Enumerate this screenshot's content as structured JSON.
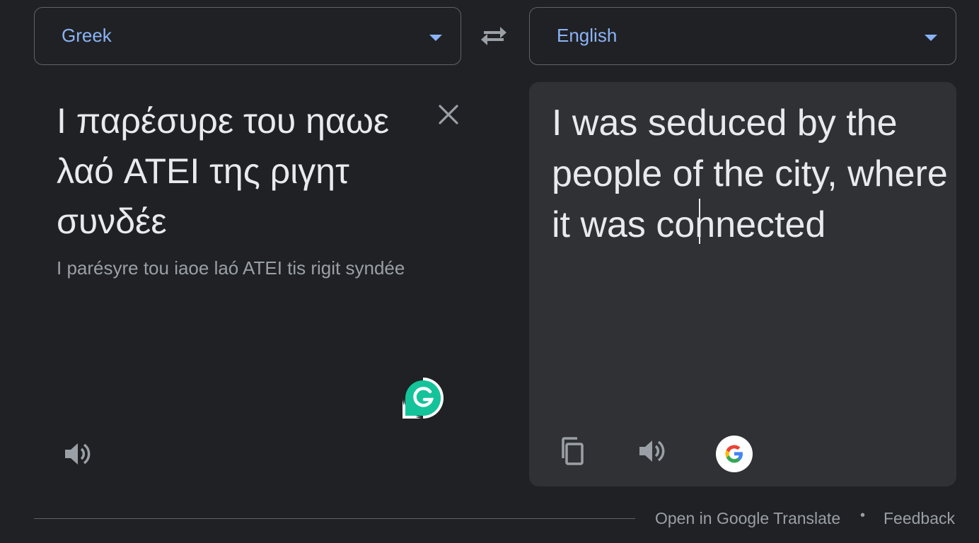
{
  "source_language": {
    "label": "Greek"
  },
  "target_language": {
    "label": "English"
  },
  "source": {
    "text": "Ι παρέσυρε του ηαωε λαό ATEI της ριγητ συνδέε",
    "transliteration": "I parésyre tou iaoe laó ATEI tis rigit syndée"
  },
  "target": {
    "text": "I was seduced by the people of the city, where it was connected"
  },
  "footer": {
    "open_link": "Open in Google Translate",
    "separator": "•",
    "feedback_link": "Feedback"
  },
  "icons": {
    "caret": "chevron-down-icon",
    "swap": "swap-icon",
    "clear": "close-icon",
    "speaker": "speaker-icon",
    "copy": "copy-icon",
    "google": "google-logo-icon",
    "grammarly": "grammarly-icon"
  },
  "colors": {
    "background": "#202124",
    "panel": "#303134",
    "accent": "#8ab4f8",
    "text": "#e8eaed",
    "secondary_text": "#9aa0a6",
    "grammarly": "#15c39a"
  }
}
